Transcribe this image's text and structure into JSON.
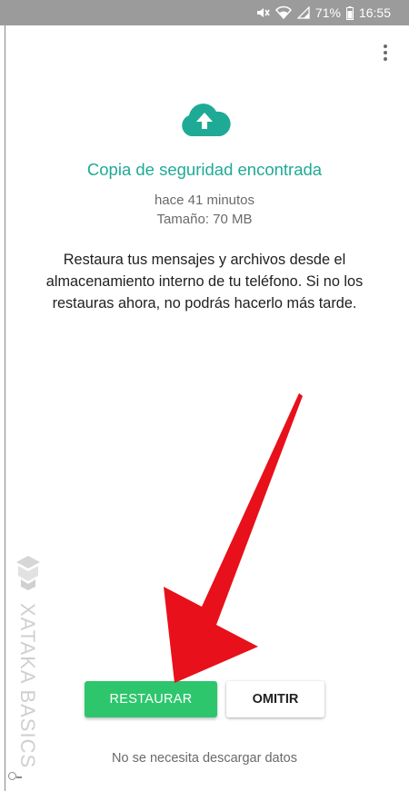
{
  "status_bar": {
    "battery_percent": "71%",
    "time": "16:55",
    "icons": [
      "mute-icon",
      "wifi-icon",
      "signal-icon",
      "battery-icon"
    ]
  },
  "toolbar": {
    "more_icon": "more-vert-icon"
  },
  "backup": {
    "icon": "cloud-upload-icon",
    "title": "Copia de seguridad encontrada",
    "time_ago": "hace 41 minutos",
    "size": "Tamaño: 70 MB",
    "description": "Restaura tus mensajes y archivos desde el almacenamiento interno de tu teléfono. Si no los restauras ahora, no podrás hacerlo más tarde."
  },
  "actions": {
    "restore_label": "RESTAURAR",
    "skip_label": "OMITIR",
    "note": "No se necesita descargar datos"
  },
  "watermark": {
    "text": "XATAKA BASICS"
  },
  "colors": {
    "accent_teal": "#1faa96",
    "button_green": "#2ec66d",
    "arrow_red": "#e8101a",
    "status_bar": "#9b9b9b"
  }
}
